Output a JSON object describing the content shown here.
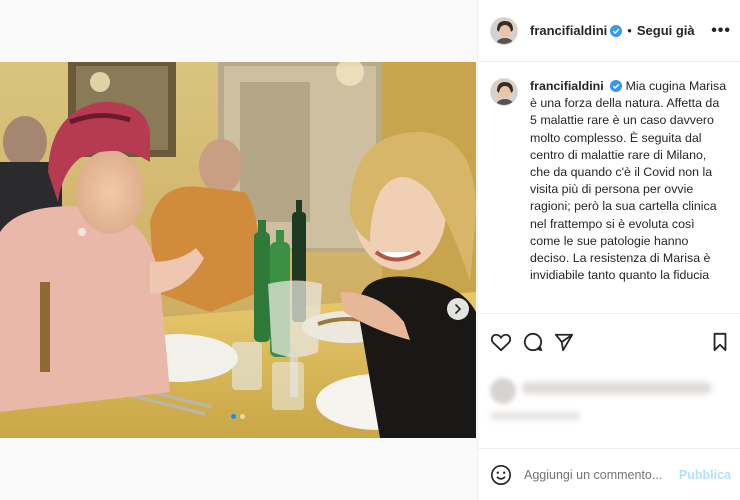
{
  "post": {
    "username": "francifialdini",
    "follow_label": "Segui già",
    "separator": "•",
    "more_label": "•••",
    "caption_username": "francifialdini",
    "caption_text": "Mia cugina Marisa è una forza della natura. Affetta da 5 malattie rare è un caso davvero molto complesso. È seguita dal centro di malattie rare di Milano, che da quando c'è il Covid non la visita più di persona per ovvie ragioni; però la sua cartella clinica nel frattempo si è evoluta così come le sue patologie hanno deciso. La resistenza di Marisa è invidiabile tanto quanto la fiducia",
    "comment_placeholder": "Aggiungi un commento...",
    "publish_label": "Pubblica"
  },
  "carousel": {
    "slides_total": 2,
    "active_slide": 1
  },
  "icons": {
    "like": "heart-icon",
    "comment": "comment-icon",
    "share": "send-icon",
    "save": "bookmark-icon",
    "emoji": "emoji-icon",
    "verified": "verified-badge-icon",
    "next": "chevron-right-icon"
  },
  "colors": {
    "verified": "#3897f0",
    "publish_disabled": "#b2dffc",
    "carousel_active": "#1a8cf0"
  }
}
